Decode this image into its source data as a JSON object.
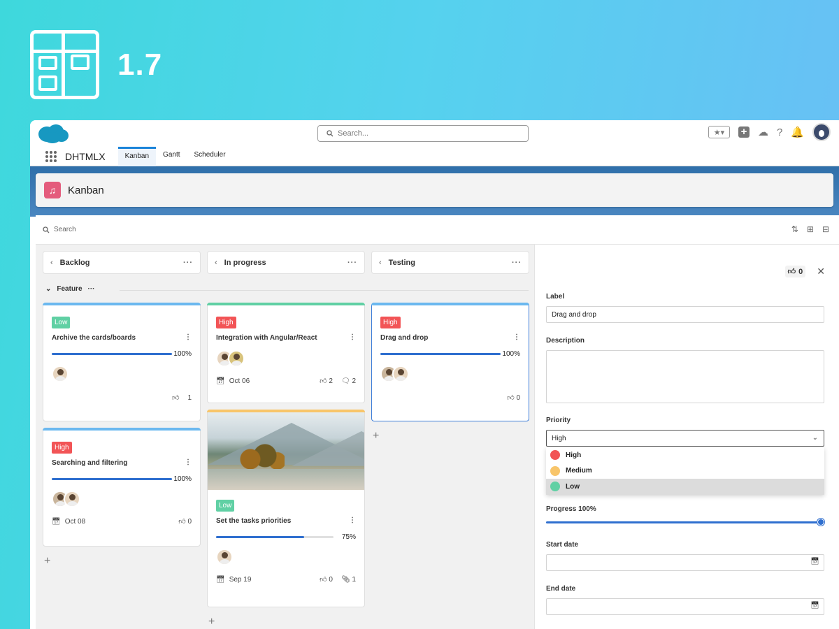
{
  "version": "1.7",
  "header": {
    "search_placeholder": "Search...",
    "app_name": "DHTMLX",
    "tabs": [
      {
        "label": "Kanban",
        "active": true
      },
      {
        "label": "Gantt",
        "active": false
      },
      {
        "label": "Scheduler",
        "active": false
      }
    ]
  },
  "page": {
    "title": "Kanban",
    "icon": "music-note-icon"
  },
  "toolbar": {
    "search_placeholder": "Search"
  },
  "columns": [
    {
      "label": "Backlog"
    },
    {
      "label": "In progress"
    },
    {
      "label": "Testing"
    }
  ],
  "swimlane": {
    "label": "Feature"
  },
  "cards": {
    "archive": {
      "priority": "Low",
      "title": "Archive the cards/boards",
      "progress": "100%",
      "likes": "1"
    },
    "search": {
      "priority": "High",
      "title": "Searching and filtering",
      "progress": "100%",
      "date": "Oct 08",
      "likes": "0"
    },
    "integration": {
      "priority": "High",
      "title": "Integration with Angular/React",
      "date": "Oct 06",
      "likes": "2",
      "comments": "2"
    },
    "priorities": {
      "priority": "Low",
      "title": "Set the tasks priorities",
      "progress": "75%",
      "date": "Sep 19",
      "likes": "0",
      "attachments": "1"
    },
    "dnd": {
      "priority": "High",
      "title": "Drag and drop",
      "progress": "100%",
      "likes": "0"
    }
  },
  "editor": {
    "likes": "0",
    "label_title": "Label",
    "label_value": "Drag and drop",
    "description_title": "Description",
    "description_value": "",
    "priority_title": "Priority",
    "priority_value": "High",
    "priority_options": [
      {
        "label": "High",
        "color": "#f25456"
      },
      {
        "label": "Medium",
        "color": "#f8c56a"
      },
      {
        "label": "Low",
        "color": "#60d0a4"
      }
    ],
    "progress_title": "Progress 100%",
    "progress_value": 1.0,
    "start_date_title": "Start date",
    "end_date_title": "End date"
  },
  "colors": {
    "accent": "#2f6fcf",
    "low": "#60d0a4",
    "high": "#f25456",
    "medium": "#f8c56a"
  }
}
